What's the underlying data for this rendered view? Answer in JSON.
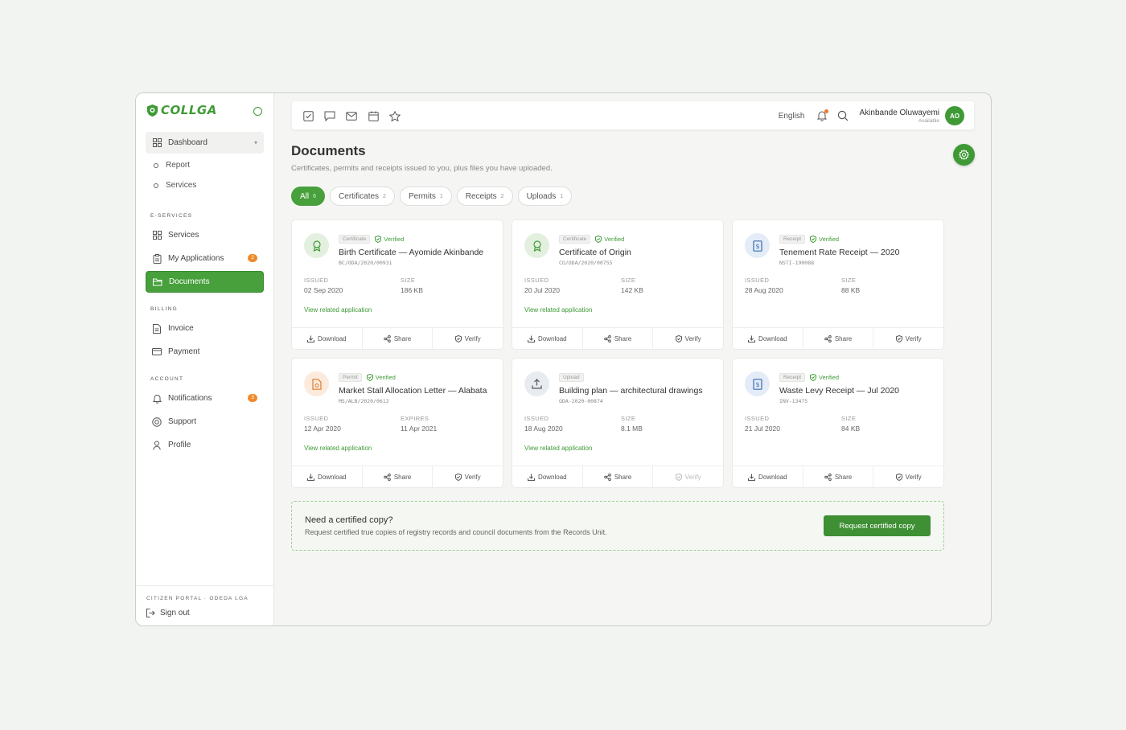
{
  "brand": {
    "name": "COLLGA"
  },
  "sidebar": {
    "dashboard": "Dashboard",
    "dashboard_sub": [
      "Report",
      "Services"
    ],
    "sections": {
      "eservices": "E-SERVICES",
      "billing": "BILLING",
      "account": "ACCOUNT"
    },
    "eservices_items": [
      {
        "label": "Services"
      },
      {
        "label": "My Applications",
        "badge": "2"
      },
      {
        "label": "Documents",
        "active": true
      }
    ],
    "billing_items": [
      {
        "label": "Invoice"
      },
      {
        "label": "Payment"
      }
    ],
    "account_items": [
      {
        "label": "Notifications",
        "badge": "3"
      },
      {
        "label": "Support"
      },
      {
        "label": "Profile"
      }
    ],
    "footer_label": "CITIZEN PORTAL · ODEDA LGA",
    "sign_out": "Sign out"
  },
  "topbar": {
    "language": "English",
    "user_name": "Akinbande Oluwayemi",
    "user_status": "Available",
    "avatar_initials": "AO",
    "icons": [
      "checkbox-icon",
      "chat-icon",
      "mail-icon",
      "calendar-icon",
      "star-icon"
    ]
  },
  "page": {
    "title": "Documents",
    "subtitle": "Certificates, permits and receipts issued to you, plus files you have uploaded."
  },
  "filters": [
    {
      "label": "All",
      "count": "6",
      "active": true
    },
    {
      "label": "Certificates",
      "count": "2"
    },
    {
      "label": "Permits",
      "count": "1"
    },
    {
      "label": "Receipts",
      "count": "2"
    },
    {
      "label": "Uploads",
      "count": "1"
    }
  ],
  "cards": [
    {
      "kind": "Certificate",
      "verified": "Verified",
      "title": "Birth Certificate — Ayomide Akinbande",
      "ref": "BC/ODA/2020/00931",
      "meta1_label": "ISSUED",
      "meta1_value": "02 Sep 2020",
      "meta2_label": "SIZE",
      "meta2_value": "186 KB",
      "link": "View related application",
      "download": "Download",
      "share": "Share",
      "verify": "Verify"
    },
    {
      "kind": "Certificate",
      "verified": "Verified",
      "title": "Certificate of Origin",
      "ref": "CO/ODA/2020/00755",
      "meta1_label": "ISSUED",
      "meta1_value": "20 Jul 2020",
      "meta2_label": "SIZE",
      "meta2_value": "142 KB",
      "link": "View related application",
      "download": "Download",
      "share": "Share",
      "verify": "Verify"
    },
    {
      "kind": "Receipt",
      "verified": "Verified",
      "title": "Tenement Rate Receipt — 2020",
      "ref": "NSTI-190088",
      "meta1_label": "ISSUED",
      "meta1_value": "28 Aug 2020",
      "meta2_label": "SIZE",
      "meta2_value": "88 KB",
      "download": "Download",
      "share": "Share",
      "verify": "Verify"
    },
    {
      "kind": "Permit",
      "verified": "Verified",
      "title": "Market Stall Allocation Letter — Alabata",
      "ref": "MS/ALB/2020/0612",
      "meta1_label": "ISSUED",
      "meta1_value": "12 Apr 2020",
      "meta2_label": "EXPIRES",
      "meta2_value": "11 Apr 2021",
      "link": "View related application",
      "download": "Download",
      "share": "Share",
      "verify": "Verify"
    },
    {
      "kind": "Upload",
      "title": "Building plan — architectural drawings",
      "ref": "ODA-2020-00874",
      "meta1_label": "ISSUED",
      "meta1_value": "18 Aug 2020",
      "meta2_label": "SIZE",
      "meta2_value": "8.1 MB",
      "link": "View related application",
      "download": "Download",
      "share": "Share",
      "verify": "Verify"
    },
    {
      "kind": "Receipt",
      "verified": "Verified",
      "title": "Waste Levy Receipt — Jul 2020",
      "ref": "INV-13475",
      "meta1_label": "ISSUED",
      "meta1_value": "21 Jul 2020",
      "meta2_label": "SIZE",
      "meta2_value": "84 KB",
      "download": "Download",
      "share": "Share",
      "verify": "Verify"
    }
  ],
  "cta": {
    "title": "Need a certified copy?",
    "description": "Request certified true copies of registry records and council documents from the Records Unit.",
    "button": "Request certified copy"
  },
  "colors": {
    "brand": "#3f9a36",
    "badge": "#ee8a2a"
  }
}
